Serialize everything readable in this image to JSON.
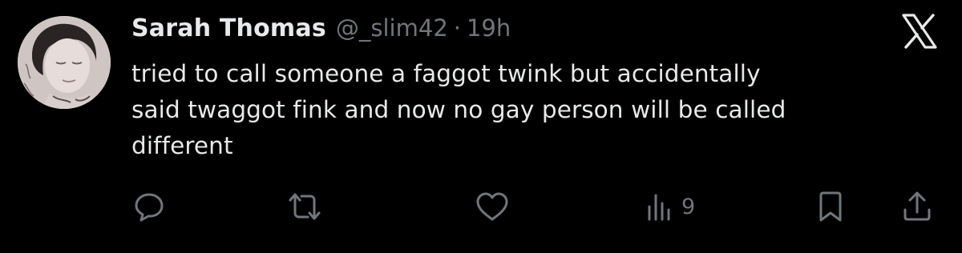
{
  "tweet": {
    "display_name": "Sarah Thomas",
    "handle": "@_slim42",
    "separator": "·",
    "time": "19h",
    "text": "tried to call someone a faggot twink but accidentally\nsaid twaggot fink and now no gay person will be called\ndifferent"
  },
  "brand": {
    "logo": "x-logo-icon"
  },
  "actions": {
    "reply_icon": "reply-icon",
    "retweet_icon": "retweet-icon",
    "like_icon": "heart-icon",
    "views_icon": "views-bar-chart-icon",
    "views_count": "9",
    "bookmark_icon": "bookmark-icon",
    "share_icon": "share-icon"
  },
  "colors": {
    "background": "#000000",
    "primary_text": "#e7e9ea",
    "secondary_text": "#71767b",
    "icon": "#71767b"
  }
}
